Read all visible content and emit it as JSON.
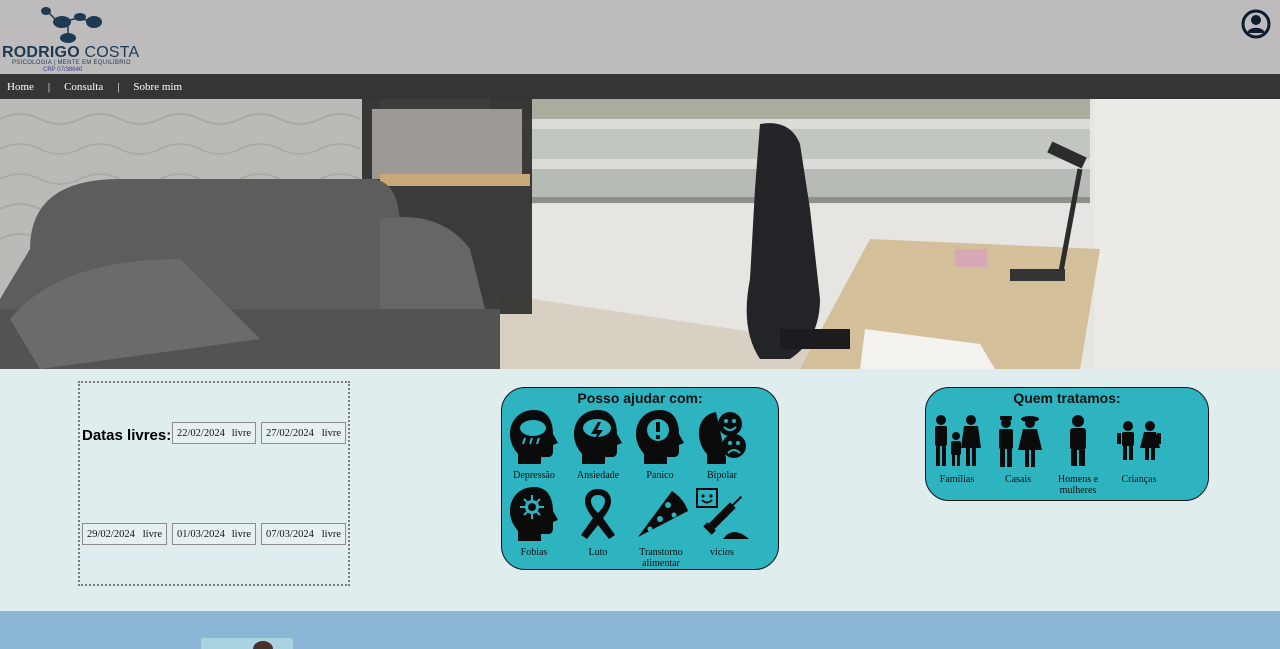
{
  "brand": {
    "name_bold": "RODRIGO",
    "name_regular": " COSTA",
    "tagline": "PSICOLOGIA | MENTE EM EQUILÍBRIO",
    "crp": "CRP 07/38640"
  },
  "nav": {
    "items": [
      {
        "label": "Home"
      },
      {
        "label": "Consulta"
      },
      {
        "label": "Sobre mim"
      }
    ],
    "separator": "|"
  },
  "dates": {
    "title": "Datas livres:",
    "slots": [
      {
        "date": "22/02/2024",
        "status": "livre"
      },
      {
        "date": "27/02/2024",
        "status": "livre"
      },
      {
        "date": "29/02/2024",
        "status": "livre"
      },
      {
        "date": "01/03/2024",
        "status": "livre"
      },
      {
        "date": "07/03/2024",
        "status": "livre"
      }
    ]
  },
  "help": {
    "title": "Posso ajudar com:",
    "items": [
      {
        "label": "Depressão",
        "icon": "head-rain-cloud-icon"
      },
      {
        "label": "Ansiedade",
        "icon": "head-storm-cloud-icon"
      },
      {
        "label": "Panico",
        "icon": "head-alert-icon"
      },
      {
        "label": "Bipolar",
        "icon": "bipolar-faces-icon"
      },
      {
        "label": "Fobias",
        "icon": "head-virus-icon"
      },
      {
        "label": "Luto",
        "icon": "mourning-ribbon-icon"
      },
      {
        "label": "Transtorno alimentar",
        "icon": "pizza-slice-icon"
      },
      {
        "label": "vicios",
        "icon": "syringe-drugs-icon"
      }
    ]
  },
  "treat": {
    "title": "Quem tratamos:",
    "items": [
      {
        "label": "Famílias",
        "icon": "family-icon"
      },
      {
        "label": "Casais",
        "icon": "couple-icon"
      },
      {
        "label": "Homens e mulheres",
        "icon": "person-icon"
      },
      {
        "label": "Crianças",
        "icon": "children-icon"
      }
    ]
  },
  "colors": {
    "header_bg": "#bdbbbc",
    "nav_bg": "#353535",
    "page_bg": "#dfedee",
    "card_bg": "#2eb3c0",
    "footer_bg": "#8cb6d6",
    "brand_text": "#1d3a52"
  }
}
